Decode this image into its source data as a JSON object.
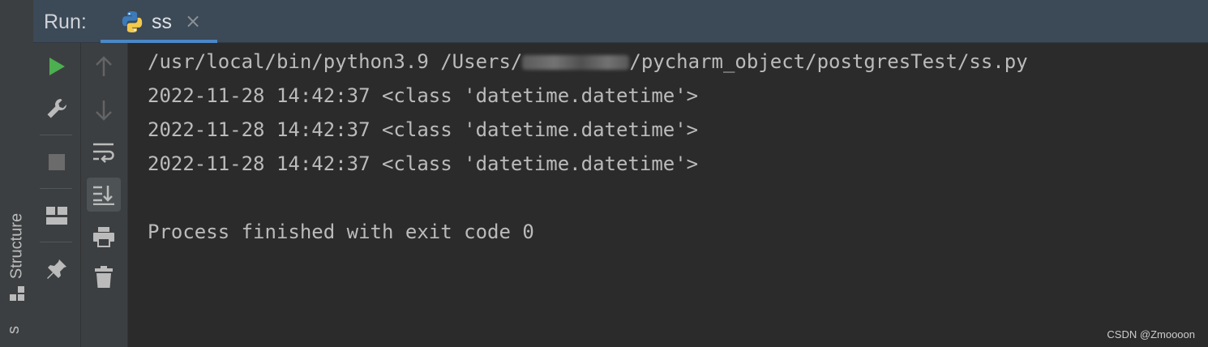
{
  "header": {
    "run_label": "Run:",
    "tab": {
      "label": "ss",
      "close": "×",
      "icon": "python-icon"
    }
  },
  "sidebar": {
    "structure_label": "Structure",
    "bottom_label": "s"
  },
  "toolbar_left": [
    {
      "name": "run-icon",
      "color": "#4caf50"
    },
    {
      "name": "wrench-icon"
    },
    {
      "name": "stop-icon"
    },
    {
      "name": "layout-icon"
    },
    {
      "name": "pin-icon"
    }
  ],
  "toolbar_right": [
    {
      "name": "arrow-up-icon"
    },
    {
      "name": "arrow-down-icon"
    },
    {
      "name": "soft-wrap-icon"
    },
    {
      "name": "scroll-to-end-icon",
      "active": true
    },
    {
      "name": "print-icon"
    },
    {
      "name": "trash-icon"
    }
  ],
  "console": {
    "command_prefix": "/usr/local/bin/python3.9 /Users/",
    "command_suffix": "/pycharm_object/postgresTest/ss.py",
    "output_lines": [
      "2022-11-28 14:42:37 <class 'datetime.datetime'>",
      "2022-11-28 14:42:37 <class 'datetime.datetime'>",
      "2022-11-28 14:42:37 <class 'datetime.datetime'>"
    ],
    "exit_message": "Process finished with exit code 0"
  },
  "watermark": "CSDN @Zmoooon",
  "colors": {
    "header_bg": "#3c4957",
    "tab_indicator": "#4a88c7",
    "console_bg": "#2b2b2b",
    "text": "#bbbbbb"
  }
}
